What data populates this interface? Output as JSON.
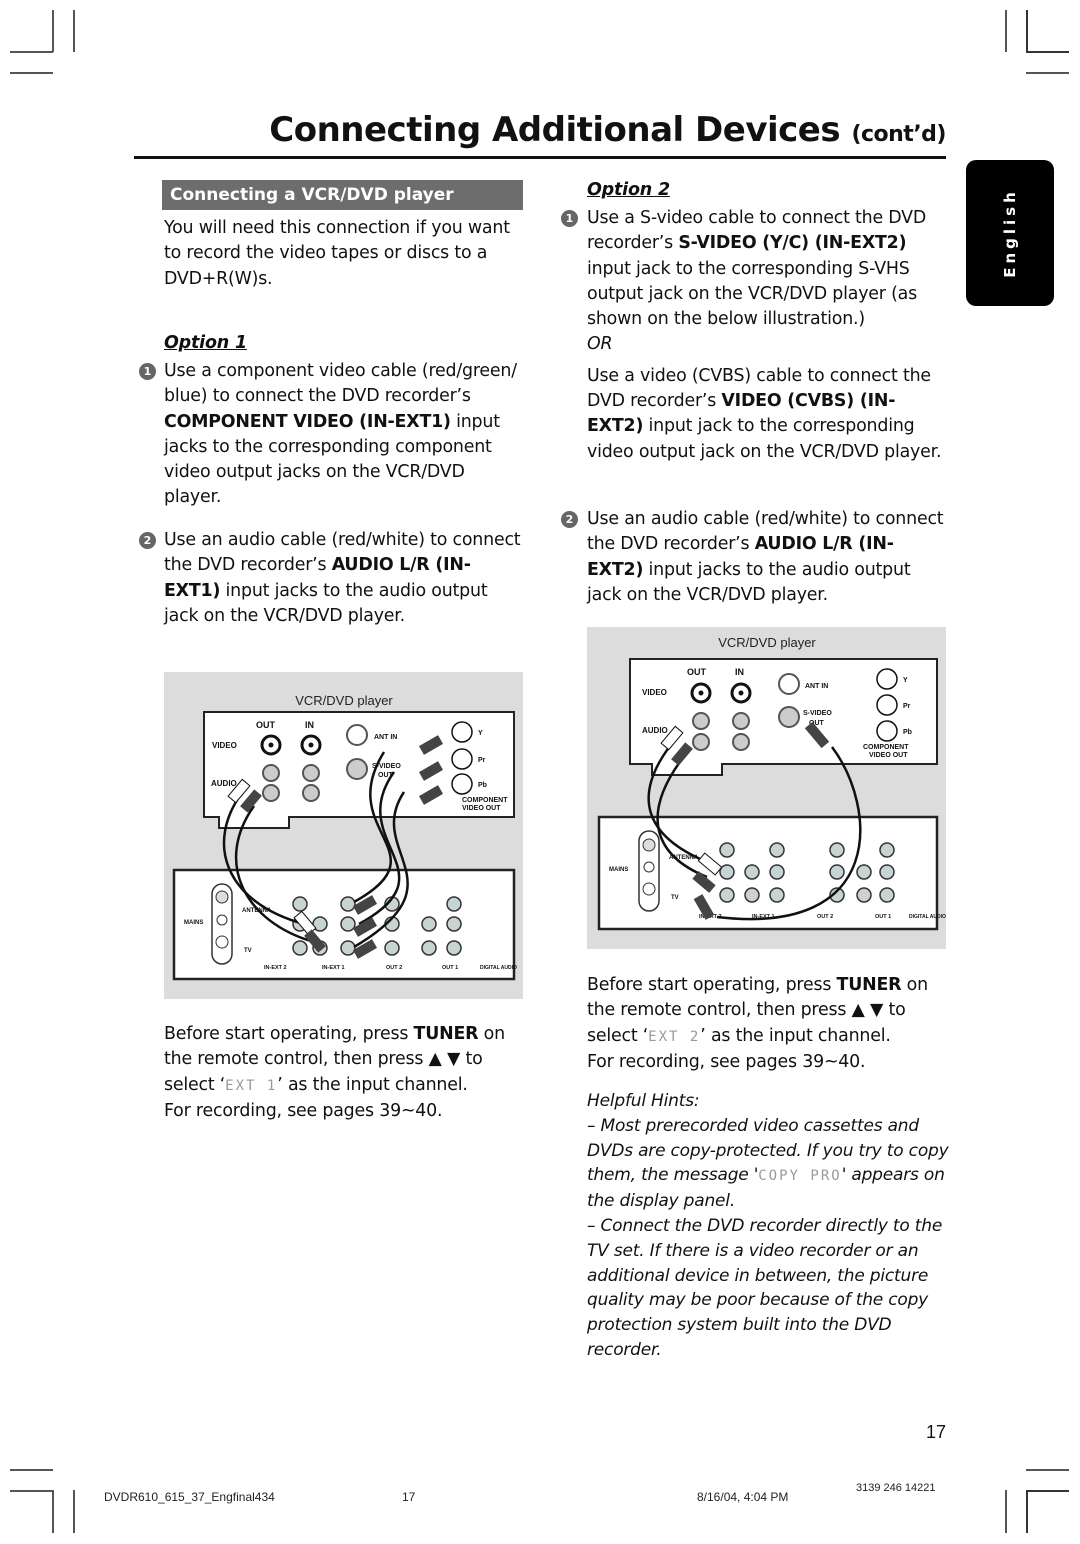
{
  "header": {
    "title": "Connecting Additional Devices",
    "title_suffix": "(cont’d)",
    "language_tab": "English"
  },
  "left": {
    "section_heading": "Connecting a VCR/DVD player",
    "intro": "You will need this connection if you want to record the video tapes or discs to a DVD+R(W)s.",
    "option_label": "Option 1",
    "steps": [
      {
        "number": "1",
        "text_before": "Use a component video cable (red/green/ blue) to connect the DVD recorder’s ",
        "bold": "COMPONENT VIDEO (IN-EXT1)",
        "text_after": " input jacks to the corresponding component video output jacks on the VCR/DVD player."
      },
      {
        "number": "2",
        "text_before": "Use an audio cable (red/white) to connect the DVD recorder’s ",
        "bold": "AUDIO L/R (IN-EXT1)",
        "text_after": " input jacks to the audio output jack on the VCR/DVD player."
      }
    ],
    "diagram_caption": "VCR/DVD player",
    "tuner_text_1": "Before start operating, press ",
    "tuner_bold": "TUNER",
    "tuner_text_2": " on the remote control, then press ▲ ▼ to select ‘",
    "tuner_lcd": "EXT 1",
    "tuner_text_3": "’ as the input channel.",
    "recording_text": "For recording, see pages 39~40."
  },
  "right": {
    "option_label": "Option 2",
    "steps": [
      {
        "number": "1",
        "text_before": "Use a S-video cable to connect the DVD recorder’s ",
        "bold": "S-VIDEO (Y/C) (IN-EXT2)",
        "text_after": " input jack to the corresponding S-VHS output jack on the VCR/DVD player (as shown on the below illustration.)",
        "or_label": "OR",
        "alt_before": "Use a video (CVBS) cable to connect the DVD recorder’s ",
        "alt_bold": "VIDEO (CVBS) (IN-EXT2)",
        "alt_after": " input jack to the corresponding video output jack on the VCR/DVD player."
      },
      {
        "number": "2",
        "text_before": "Use an audio cable (red/white) to connect the DVD recorder’s ",
        "bold": "AUDIO L/R (IN-EXT2)",
        "text_after": " input jacks to the audio output jack on the VCR/DVD player."
      }
    ],
    "diagram_caption": "VCR/DVD player",
    "tuner_text_1": "Before start operating, press ",
    "tuner_bold": "TUNER",
    "tuner_text_2": " on the remote control, then press ▲ ▼ to select ‘",
    "tuner_lcd": "EXT 2",
    "tuner_text_3": "’ as the input channel.",
    "recording_text": "For recording, see pages 39~40.",
    "hints_title": "Helpful Hints:",
    "hint1_before": "– Most prerecorded video cassettes and DVDs are copy-protected. If you try to copy them, the message '",
    "hint1_lcd": "COPY PRO",
    "hint1_after": "' appears on the display panel.",
    "hint2": "– Connect the DVD recorder directly to the TV set. If there is a video recorder or an additional device in between, the picture quality may be poor because of the copy protection system built into the DVD recorder."
  },
  "diagram_labels": {
    "out": "OUT",
    "in": "IN",
    "video": "VIDEO",
    "audio": "AUDIO",
    "ant_in": "ANT IN",
    "s_video": "S-VIDEO",
    "s_video_out": "OUT",
    "y": "Y",
    "pr": "Pr",
    "pb": "Pb",
    "component": "COMPONENT",
    "video_out": "VIDEO OUT",
    "mains": "MAINS",
    "antenna": "ANTENNA",
    "tv": "TV",
    "in_ext2": "IN-EXT 2",
    "in_ext1": "IN-EXT 1",
    "out2": "OUT 2",
    "out1": "OUT 1",
    "digital_audio": "DIGITAL AUDIO"
  },
  "page_number": "17",
  "footer": {
    "filename": "DVDR610_615_37_Engfinal434",
    "page": "17",
    "datetime": "8/16/04, 4:04 PM",
    "code": "3139 246 14221"
  }
}
